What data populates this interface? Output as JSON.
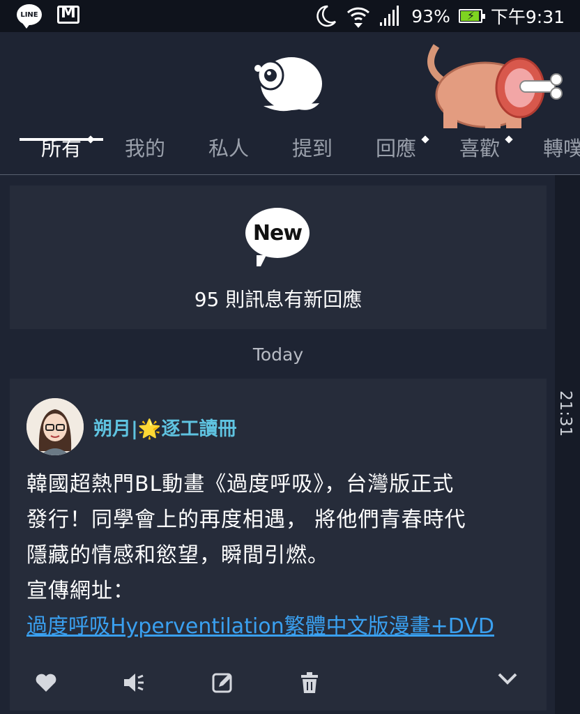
{
  "status_bar": {
    "icons_left": [
      "line-app-icon",
      "gmail-icon"
    ],
    "line_label": "LINE",
    "battery_percent": "93%",
    "battery_level": 0.93,
    "time": "下午9:31",
    "icons_right": [
      "moon-icon",
      "wifi-icon",
      "signal-icon",
      "battery-icon"
    ]
  },
  "header": {
    "tabs": [
      {
        "label": "所有",
        "active": true,
        "has_dot": true
      },
      {
        "label": "我的",
        "active": false,
        "has_dot": false
      },
      {
        "label": "私人",
        "active": false,
        "has_dot": false
      },
      {
        "label": "提到",
        "active": false,
        "has_dot": false
      },
      {
        "label": "回應",
        "active": false,
        "has_dot": true
      },
      {
        "label": "喜歡",
        "active": false,
        "has_dot": true
      },
      {
        "label": "轉噗",
        "active": false,
        "has_dot": false
      }
    ]
  },
  "new_notice": {
    "badge": "New",
    "text": "95 則訊息有新回應"
  },
  "date_label": "Today",
  "rail_time": "21:31",
  "post": {
    "author": "朔月|🌟逐工讀冊",
    "body_lines": [
      "韓國超熱門BL動畫《過度呼吸》，台灣版正式",
      "發行！同學會上的再度相遇， 將他們青春時代",
      "隱藏的情感和慾望，瞬間引燃。",
      "宣傳網址："
    ],
    "link": "過度呼吸Hyperventilation繁體中文版漫畫+DVD",
    "actions": [
      "heart-icon",
      "mute-icon",
      "edit-icon",
      "trash-icon",
      "chevron-down-icon"
    ]
  },
  "colors": {
    "background": "#1e2433",
    "card": "#262c3a",
    "status_bar": "#0f131c",
    "author": "#5fc3e0",
    "link": "#3aa0f0",
    "battery": "#7ed321"
  }
}
